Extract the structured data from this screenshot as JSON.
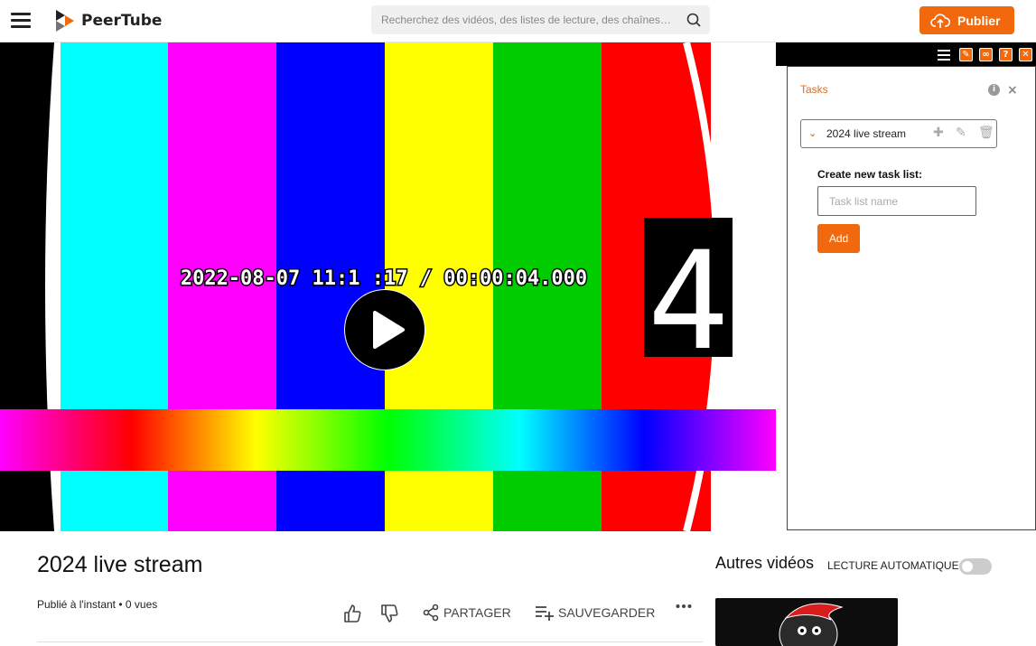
{
  "header": {
    "brand": "PeerTube",
    "search_placeholder": "Recherchez des vidéos, des listes de lecture, des chaînes…",
    "publish_label": "Publier"
  },
  "video": {
    "timestamp_overlay": "2022-08-07 11:1 :17 / 00:00:04.000",
    "countdown_digit": "4"
  },
  "tasks_panel": {
    "title": "Tasks",
    "current_list": "2024 live stream",
    "create_label": "Create new task list:",
    "input_placeholder": "Task list name",
    "add_label": "Add"
  },
  "video_info": {
    "title": "2024 live stream",
    "meta": "Publié à l'instant • 0 vues",
    "share_label": "PARTAGER",
    "save_label": "SAUVEGARDER"
  },
  "sidebar": {
    "title": "Autres vidéos",
    "autoplay_label": "LECTURE AUTOMATIQUE",
    "autoplay_on": false
  },
  "colors": {
    "accent": "#f2690d"
  }
}
